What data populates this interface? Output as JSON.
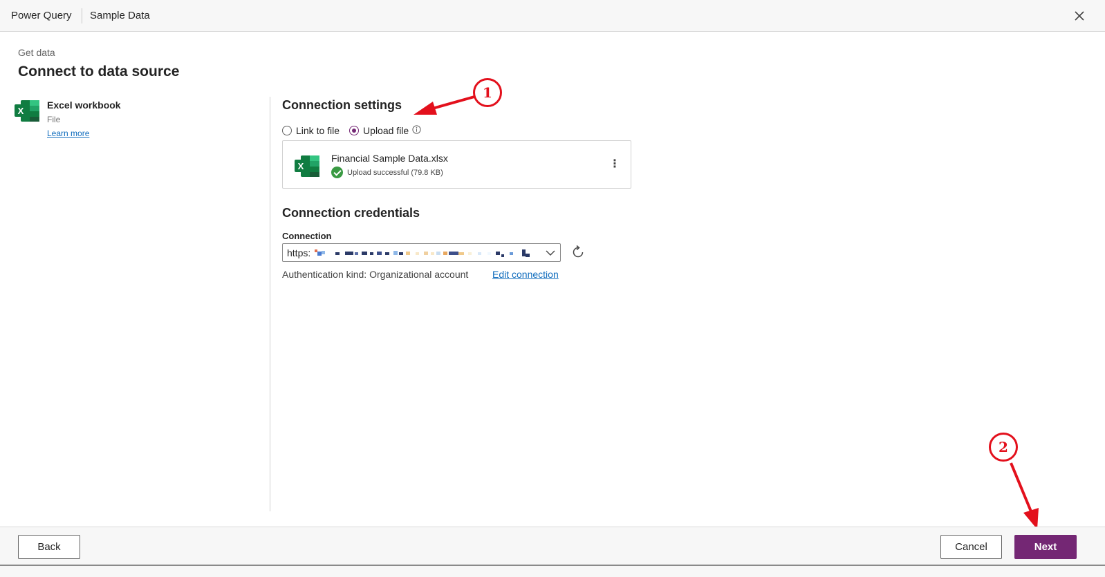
{
  "titlebar": {
    "app_name": "Power Query",
    "document_name": "Sample Data",
    "close_icon": "close-icon"
  },
  "header": {
    "breadcrumb": "Get data",
    "title": "Connect to data source"
  },
  "connector": {
    "icon": "excel-icon",
    "name": "Excel workbook",
    "type": "File",
    "learn_more": "Learn more"
  },
  "connection_settings": {
    "title": "Connection settings",
    "options": [
      {
        "label": "Link to file",
        "selected": false
      },
      {
        "label": "Upload file",
        "selected": true
      }
    ],
    "info_icon": "info-icon",
    "file": {
      "name": "Financial Sample Data.xlsx",
      "status": "Upload successful (79.8 KB)",
      "status_icon": "success-check-icon",
      "more_icon": "more-vertical-icon"
    }
  },
  "connection_credentials": {
    "title": "Connection credentials",
    "connection_label": "Connection",
    "connection_value": "https:",
    "auth_kind": "Authentication kind: Organizational account",
    "edit_link": "Edit connection",
    "refresh_icon": "refresh-icon"
  },
  "annotations": [
    {
      "label": "1"
    },
    {
      "label": "2"
    }
  ],
  "footer": {
    "back": "Back",
    "cancel": "Cancel",
    "next": "Next"
  },
  "colors": {
    "accent": "#742774",
    "link": "#0f6cbd",
    "success": "#3a9a43",
    "annotation": "#e3101c",
    "excel_green": "#107c41"
  }
}
